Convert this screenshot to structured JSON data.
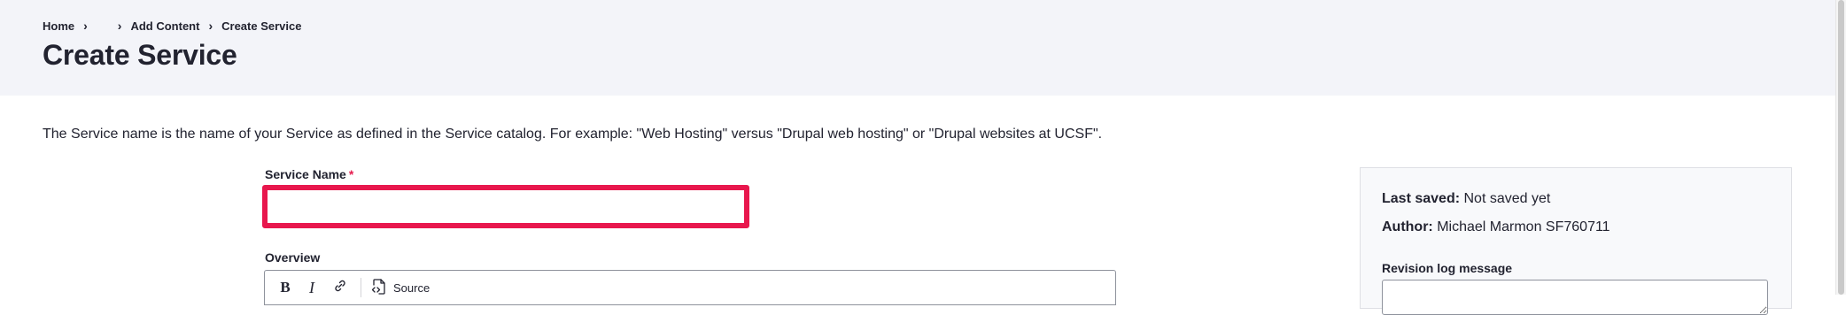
{
  "breadcrumb": {
    "home": "Home",
    "sep1": "›",
    "sep2": "›",
    "add_content": "Add Content",
    "sep3": "›",
    "current": "Create Service"
  },
  "page_title": "Create Service",
  "description": "The Service name is the name of your Service as defined in the Service catalog. For example: \"Web Hosting\" versus \"Drupal web hosting\" or \"Drupal websites at UCSF\".",
  "service_name": {
    "label": "Service Name",
    "required_marker": "*",
    "value": "",
    "placeholder": ""
  },
  "overview": {
    "label": "Overview",
    "toolbar": {
      "bold": "B",
      "italic": "I",
      "source": "Source"
    }
  },
  "sidebar": {
    "last_saved_label": "Last saved:",
    "last_saved_value": "Not saved yet",
    "author_label": "Author:",
    "author_value": "Michael Marmon SF760711",
    "revision_label": "Revision log message",
    "revision_value": ""
  },
  "colors": {
    "header_bg": "#f3f4f9",
    "error_border": "#e8174d",
    "required": "#e51e4f",
    "text": "#222330"
  }
}
